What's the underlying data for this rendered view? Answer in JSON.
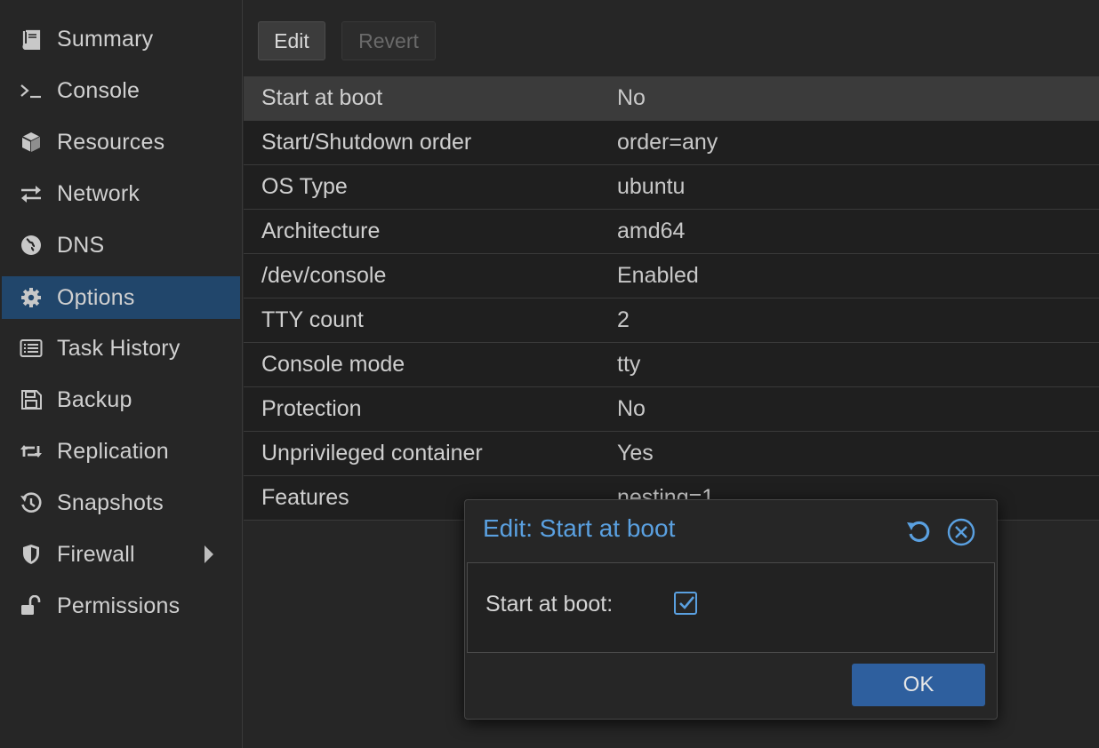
{
  "sidebar": {
    "items": [
      {
        "label": "Summary",
        "icon": "book-icon",
        "active": false
      },
      {
        "label": "Console",
        "icon": "terminal-icon",
        "active": false
      },
      {
        "label": "Resources",
        "icon": "cube-icon",
        "active": false
      },
      {
        "label": "Network",
        "icon": "exchange-icon",
        "active": false
      },
      {
        "label": "DNS",
        "icon": "globe-icon",
        "active": false
      },
      {
        "label": "Options",
        "icon": "gear-icon",
        "active": true
      },
      {
        "label": "Task History",
        "icon": "list-alt-icon",
        "active": false
      },
      {
        "label": "Backup",
        "icon": "floppy-icon",
        "active": false
      },
      {
        "label": "Replication",
        "icon": "retweet-icon",
        "active": false
      },
      {
        "label": "Snapshots",
        "icon": "history-icon",
        "active": false
      },
      {
        "label": "Firewall",
        "icon": "shield-icon",
        "active": false,
        "has_submenu": true
      },
      {
        "label": "Permissions",
        "icon": "unlock-icon",
        "active": false
      }
    ]
  },
  "toolbar": {
    "edit_label": "Edit",
    "revert_label": "Revert"
  },
  "options_grid": {
    "rows": [
      {
        "key": "Start at boot",
        "value": "No",
        "selected": true
      },
      {
        "key": "Start/Shutdown order",
        "value": "order=any"
      },
      {
        "key": "OS Type",
        "value": "ubuntu"
      },
      {
        "key": "Architecture",
        "value": "amd64"
      },
      {
        "key": "/dev/console",
        "value": "Enabled"
      },
      {
        "key": "TTY count",
        "value": "2"
      },
      {
        "key": "Console mode",
        "value": "tty"
      },
      {
        "key": "Protection",
        "value": "No"
      },
      {
        "key": "Unprivileged container",
        "value": "Yes"
      },
      {
        "key": "Features",
        "value": "nesting=1"
      }
    ]
  },
  "dialog": {
    "title": "Edit: Start at boot",
    "field_label": "Start at boot:",
    "checked": true,
    "ok_label": "OK",
    "tools": [
      "reset-icon",
      "close-icon"
    ]
  },
  "colors": {
    "background": "#262626",
    "active_nav": "#21466b",
    "accent": "#5aa0e0",
    "ok_button": "#2e5f9e"
  }
}
